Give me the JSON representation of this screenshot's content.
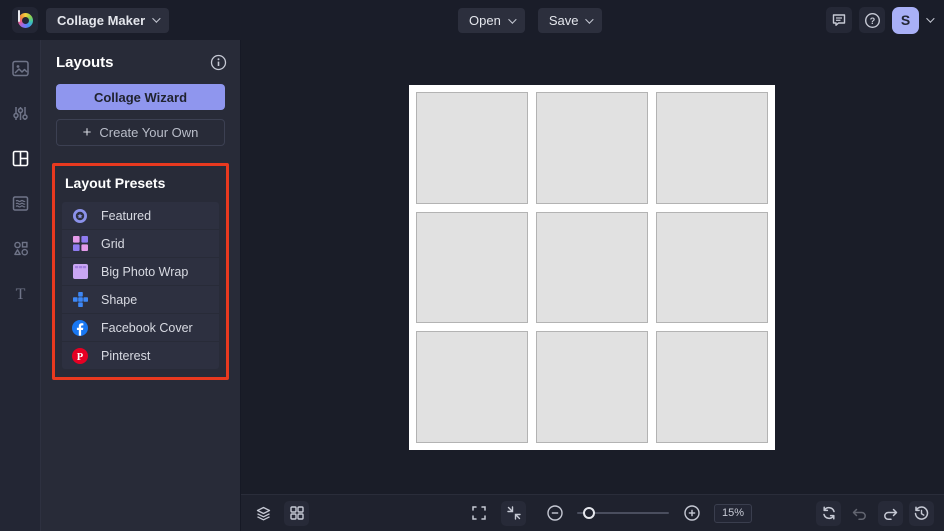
{
  "topbar": {
    "app_menu_label": "Collage Maker",
    "open_label": "Open",
    "save_label": "Save",
    "avatar_initial": "S",
    "icons": [
      "chat-icon",
      "help-icon",
      "avatar",
      "chevron-down-icon"
    ]
  },
  "sidebar": {
    "items": [
      {
        "icon": "image-manager-icon",
        "active": false
      },
      {
        "icon": "edit-sliders-icon",
        "active": false
      },
      {
        "icon": "layouts-icon",
        "active": true
      },
      {
        "icon": "patterns-icon",
        "active": false
      },
      {
        "icon": "graphics-shapes-icon",
        "active": false
      },
      {
        "icon": "text-icon",
        "active": false
      }
    ]
  },
  "panel": {
    "title": "Layouts",
    "info_icon": "info-icon",
    "wizard_button_label": "Collage Wizard",
    "create_button_label": "Create Your Own",
    "presets": {
      "title": "Layout Presets",
      "highlight_color": "#e8391f",
      "items": [
        {
          "label": "Featured",
          "icon": "featured-badge-icon"
        },
        {
          "label": "Grid",
          "icon": "grid-preset-icon"
        },
        {
          "label": "Big Photo Wrap",
          "icon": "big-photo-wrap-icon"
        },
        {
          "label": "Shape",
          "icon": "shape-preset-icon"
        },
        {
          "label": "Facebook Cover",
          "icon": "facebook-icon"
        },
        {
          "label": "Pinterest",
          "icon": "pinterest-icon"
        }
      ]
    }
  },
  "canvas": {
    "grid_rows": 3,
    "grid_cols": 3,
    "background": "#ffffff",
    "cell_color": "#e1e1e1"
  },
  "bottom_toolbar": {
    "zoom_level": "15%",
    "icons_left": [
      "layers-icon",
      "apps-grid-icon"
    ],
    "icons_center": [
      "fullscreen-icon",
      "fit-screen-icon",
      "zoom-out-icon",
      "zoom-slider",
      "zoom-in-icon"
    ],
    "icons_right": [
      "reset-icon",
      "undo-icon",
      "redo-icon",
      "history-icon"
    ]
  },
  "colors": {
    "accent_periwinkle": "#8f96ee",
    "avatar_bg": "#a9b0f7",
    "highlight_red": "#e8391f",
    "facebook_blue": "#1877f2",
    "pinterest_red": "#e60023",
    "topbar_bg": "#1a1d29",
    "panel_bg": "#282b38",
    "workspace_bg": "#1a1d28"
  }
}
